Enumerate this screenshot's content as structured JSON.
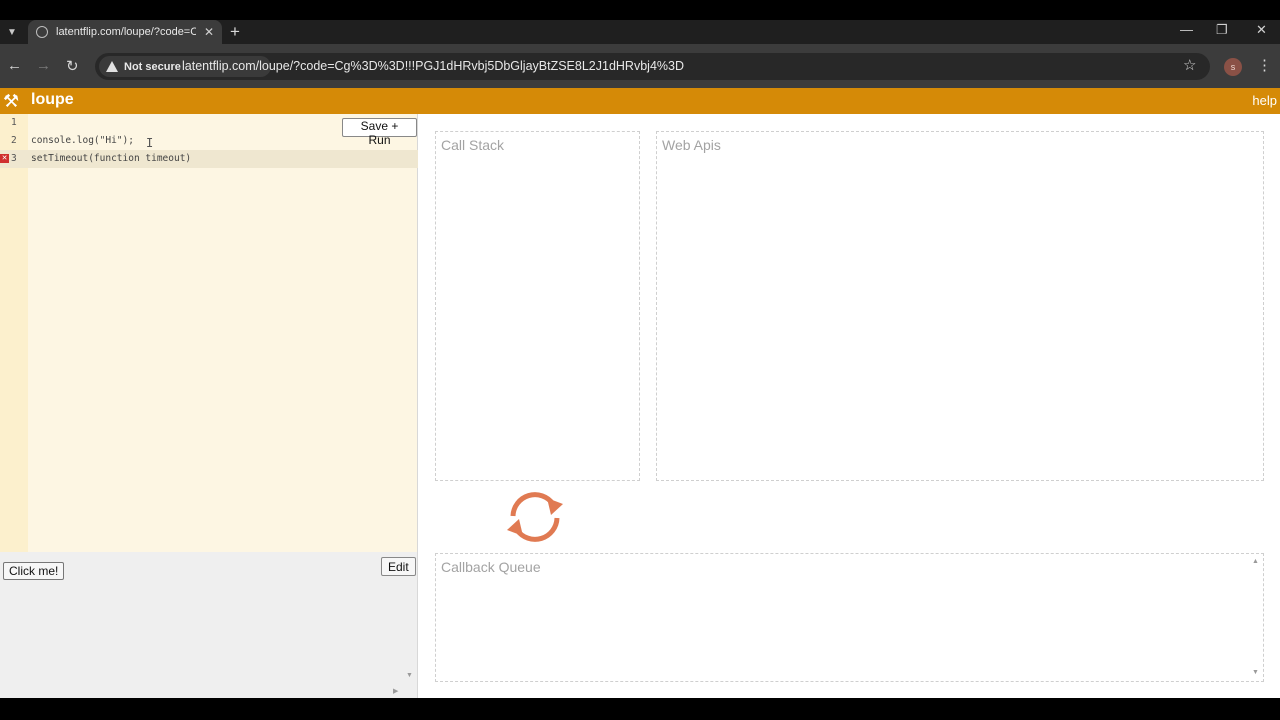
{
  "browser": {
    "tab_title": "latentflip.com/loupe/?code=Cg",
    "security_label": "Not secure",
    "url": "latentflip.com/loupe/?code=Cg%3D%3D!!!PGJ1dHRvbj5DbGljayBtZSE8L2J1dHRvbj4%3D",
    "profile_initial": "s"
  },
  "app": {
    "brand": "loupe",
    "help_label": "help",
    "save_run_label": "Save + Run",
    "editor_lines": [
      {
        "num": "1",
        "code": ""
      },
      {
        "num": "2",
        "code": "console.log(\"Hi\");"
      },
      {
        "num": "3",
        "code": "setTimeout(function timeout)"
      }
    ],
    "click_me_label": "Click me!",
    "edit_label": "Edit",
    "call_stack_title": "Call Stack",
    "web_apis_title": "Web Apis",
    "callback_queue_title": "Callback Queue"
  },
  "colors": {
    "header": "#d58a07",
    "loop_icon": "#e07a52"
  }
}
